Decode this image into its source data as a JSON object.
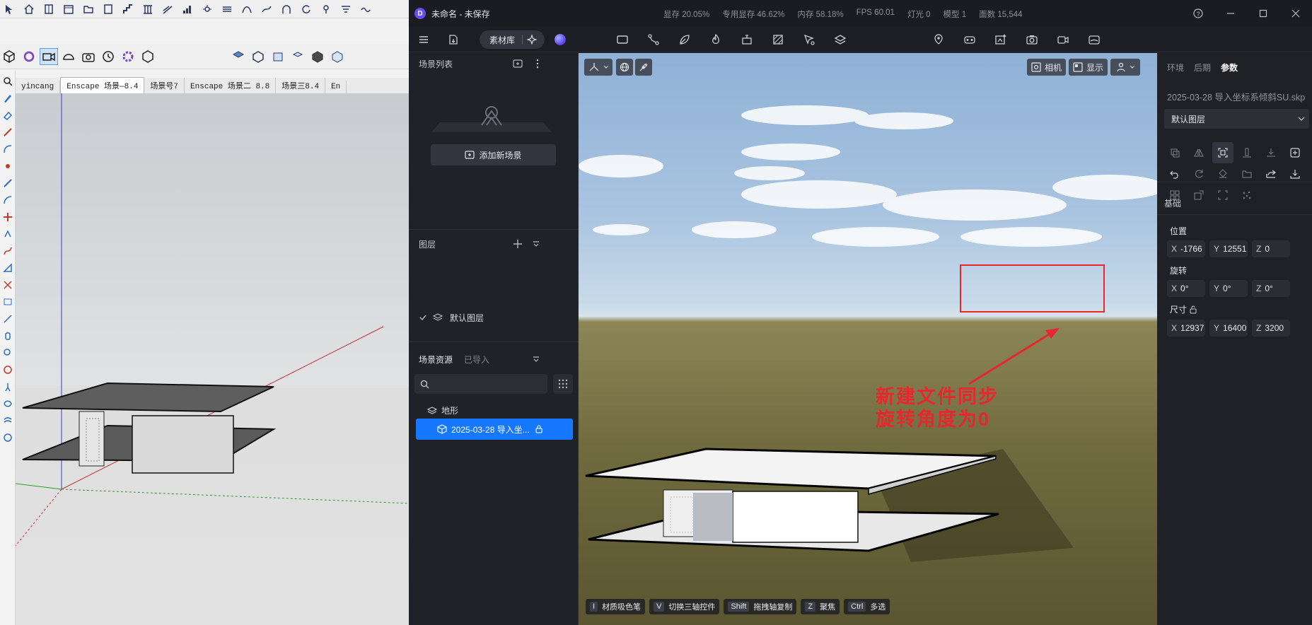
{
  "sketchup": {
    "tabs": [
      "yincang",
      "Enscape 场景—8.4",
      "场景号7",
      "Enscape 场景二 8.8",
      "场景三8.4",
      "En"
    ]
  },
  "d5": {
    "window_title": "未命名 - 未保存",
    "stats": [
      "显存 20.05%",
      "专用显存 46.62%",
      "内存 58.18%",
      "FPS 60.01",
      "灯光 0",
      "模型 1",
      "面数 15,544"
    ],
    "toolbar": {
      "asset_library": "素材库"
    },
    "left_panel": {
      "scene_list_title": "场景列表",
      "add_scene_label": "添加新场景",
      "layers_title": "图层",
      "default_layer": "默认图层",
      "scene_assets_tab": "场景资源",
      "imported_tab": "已导入",
      "search_placeholder": "",
      "resources": [
        {
          "label": "地形",
          "icon": "terrain-icon"
        },
        {
          "label": "2025-03-28 导入坐...",
          "icon": "model-icon"
        }
      ]
    },
    "viewport": {
      "camera_label": "相机",
      "display_label": "显示",
      "annotation_lines": [
        "新建文件同步",
        "旋转角度为0"
      ],
      "hints": [
        {
          "key": "I",
          "label": "材质吸色笔"
        },
        {
          "key": "V",
          "label": "切换三轴控件"
        },
        {
          "key": "Shift",
          "label": "拖拽轴复制"
        },
        {
          "key": "Z",
          "label": "聚焦"
        },
        {
          "key": "Ctrl",
          "label": "多选"
        }
      ]
    },
    "right_panel": {
      "tabs": [
        "环境",
        "后期",
        "参数"
      ],
      "active_tab": "参数",
      "file_name": "2025-03-28 导入坐标系倾斜SU.skp",
      "layer_select": "默认图层",
      "basic_title": "基础",
      "position": {
        "label": "位置",
        "x": "-1766",
        "y": "12551",
        "z": "0"
      },
      "rotation": {
        "label": "旋转",
        "x": "0°",
        "y": "0°",
        "z": "0°"
      },
      "size": {
        "label": "尺寸",
        "x": "12937",
        "y": "16400",
        "z": "3200"
      }
    },
    "colors": {
      "accent": "#1677ff",
      "annotation": "#e8262d",
      "orb": "#6a52f0"
    }
  }
}
